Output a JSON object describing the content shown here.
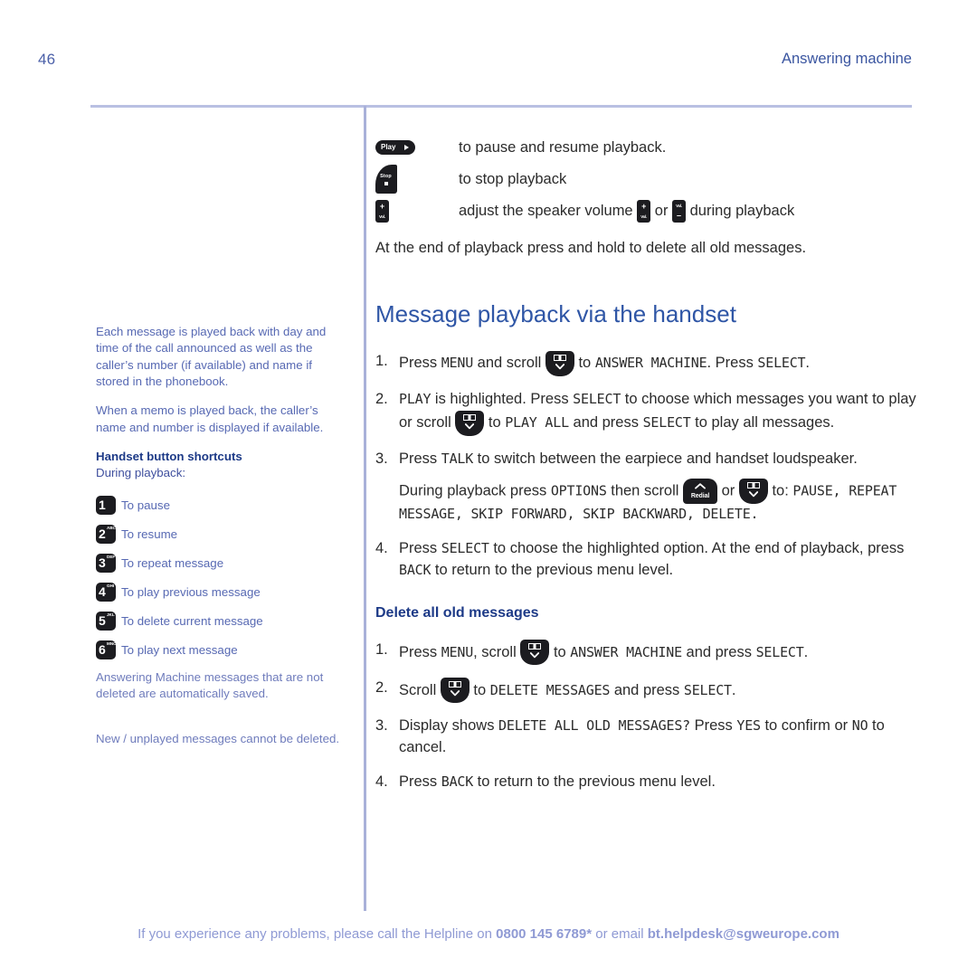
{
  "header": {
    "page_number": "46",
    "section_title": "Answering machine"
  },
  "sidebar": {
    "paragraphs": [
      "Each message is played back with day and time of the call announced as well as the caller’s number (if available) and name if stored in the phonebook.",
      "When a memo is played back, the caller’s name and number is displayed if available."
    ],
    "shortcuts_heading": "Handset button shortcuts",
    "shortcuts_subtitle": "During playback:",
    "shortcuts": [
      {
        "key": "1",
        "letters": "",
        "label": "To pause"
      },
      {
        "key": "2",
        "letters": "ABC",
        "label": "To resume"
      },
      {
        "key": "3",
        "letters": "DEF",
        "label": "To repeat message"
      },
      {
        "key": "4",
        "letters": "GHI",
        "label": "To play previous message"
      },
      {
        "key": "5",
        "letters": "JKL",
        "label": "To delete current message"
      },
      {
        "key": "6",
        "letters": "MNO",
        "label": "To play next message"
      }
    ],
    "note_1": "Answering Machine messages that are not deleted are automatically saved.",
    "note_2": "New / unplayed messages cannot be deleted."
  },
  "icons": {
    "play_label": "Play",
    "stop_label": "Stop",
    "vol_label": "Vol.",
    "plus": "+",
    "minus": "–",
    "redial_label": "Redial"
  },
  "main": {
    "icon_lines": [
      {
        "icon": "play-button-icon",
        "text": "to pause and resume playback."
      },
      {
        "icon": "stop-button-icon",
        "text": "to stop playback"
      },
      {
        "icon": "volume-button-icon",
        "text_before": "adjust the speaker volume ",
        "text_mid": " or ",
        "text_after": " during playback"
      }
    ],
    "delete_all_note": "At the end of playback press and hold to delete all old messages.",
    "heading": "Message playback via the handset",
    "steps": [
      {
        "num": "1.",
        "parts": [
          {
            "t": "Press "
          },
          {
            "m": "MENU"
          },
          {
            "t": " and scroll "
          },
          {
            "icon": "scroll-down-icon"
          },
          {
            "t": " to "
          },
          {
            "m": "ANSWER MACHINE"
          },
          {
            "t": ". Press "
          },
          {
            "m": "SELECT"
          },
          {
            "t": "."
          }
        ]
      },
      {
        "num": "2.",
        "parts": [
          {
            "m": "PLAY"
          },
          {
            "t": " is highlighted. Press "
          },
          {
            "m": "SELECT"
          },
          {
            "t": " to choose which messages you want to play or scroll "
          },
          {
            "icon": "scroll-down-icon"
          },
          {
            "t": " to "
          },
          {
            "m": "PLAY ALL"
          },
          {
            "t": " and press "
          },
          {
            "m": "SELECT"
          },
          {
            "t": " to play all messages."
          }
        ]
      },
      {
        "num": "3.",
        "parts": [
          {
            "t": "Press "
          },
          {
            "m": "TALK"
          },
          {
            "t": " to switch between the earpiece and handset loudspeaker."
          }
        ],
        "sub_parts": [
          {
            "t": "During playback press "
          },
          {
            "m": "OPTIONS"
          },
          {
            "t": " then scroll "
          },
          {
            "icon": "redial-up-icon"
          },
          {
            "t": " or "
          },
          {
            "icon": "scroll-down-icon"
          },
          {
            "t": " to: "
          },
          {
            "m": "PAUSE, REPEAT MESSAGE, SKIP FORWARD, SKIP BACKWARD, DELETE."
          }
        ]
      },
      {
        "num": "4.",
        "parts": [
          {
            "t": "Press "
          },
          {
            "m": "SELECT"
          },
          {
            "t": " to choose the highlighted option. At the end of playback, press "
          },
          {
            "m": "BACK"
          },
          {
            "t": " to return to the previous menu level."
          }
        ]
      }
    ],
    "delete_heading": "Delete all old messages",
    "delete_steps": [
      {
        "num": "1.",
        "parts": [
          {
            "t": "Press "
          },
          {
            "m": "MENU"
          },
          {
            "t": ", scroll "
          },
          {
            "icon": "scroll-down-icon"
          },
          {
            "t": " to "
          },
          {
            "m": "ANSWER MACHINE"
          },
          {
            "t": " and press "
          },
          {
            "m": "SELECT"
          },
          {
            "t": "."
          }
        ]
      },
      {
        "num": "2.",
        "parts": [
          {
            "t": "Scroll "
          },
          {
            "icon": "scroll-down-icon"
          },
          {
            "t": " to "
          },
          {
            "m": "DELETE MESSAGES"
          },
          {
            "t": " and press "
          },
          {
            "m": "SELECT"
          },
          {
            "t": "."
          }
        ]
      },
      {
        "num": "3.",
        "parts": [
          {
            "t": "Display shows "
          },
          {
            "m": "DELETE ALL OLD MESSAGES?"
          },
          {
            "t": " Press "
          },
          {
            "m": "YES"
          },
          {
            "t": " to confirm or "
          },
          {
            "m": "NO"
          },
          {
            "t": " to cancel."
          }
        ]
      },
      {
        "num": "4.",
        "parts": [
          {
            "t": "Press "
          },
          {
            "m": "BACK"
          },
          {
            "t": " to return to the previous menu level."
          }
        ]
      }
    ]
  },
  "footer": {
    "text_1": "If you experience any problems, please call the Helpline on ",
    "phone": "0800 145 6789*",
    "text_2": " or email ",
    "email": "bt.helpdesk@sgweurope.com"
  },
  "colors": {
    "accent_blue": "#2f56a6",
    "sidebar_blue": "#5769b3",
    "rule": "#b9c0e2",
    "footer": "#8f9ad4",
    "key_dark": "#1c1c20"
  }
}
